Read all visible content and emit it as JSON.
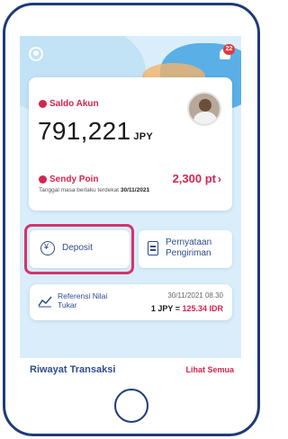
{
  "header": {
    "notification_count": "22"
  },
  "balance": {
    "label": "Saldo Akun",
    "amount": "791,221",
    "currency": "JPY"
  },
  "points": {
    "label": "Sendy Poin",
    "value": "2,300 pt",
    "chevron": "›",
    "expiry_label": "Tanggal masa berlaku terdekat",
    "expiry_date": "30/11/2021"
  },
  "actions": {
    "deposit_label": "Deposit",
    "statement_label_line1": "Pernyataan",
    "statement_label_line2": "Pengiriman"
  },
  "exchange_rate": {
    "label_line1": "Referensi Nilai",
    "label_line2": "Tukar",
    "datetime": "30/11/2021 08.30",
    "base": "1 JPY = ",
    "rate": "125.34 IDR"
  },
  "history": {
    "title": "Riwayat Transaksi",
    "see_all_label": "Lihat Semua"
  },
  "colors": {
    "accent": "#d6244f",
    "primary": "#2e4c8a",
    "frame": "#1f3a7a",
    "highlight": "#d6336c"
  },
  "icons": [
    "profile-icon",
    "bell-icon",
    "avatar",
    "deposit-icon",
    "document-icon",
    "chart-icon"
  ]
}
